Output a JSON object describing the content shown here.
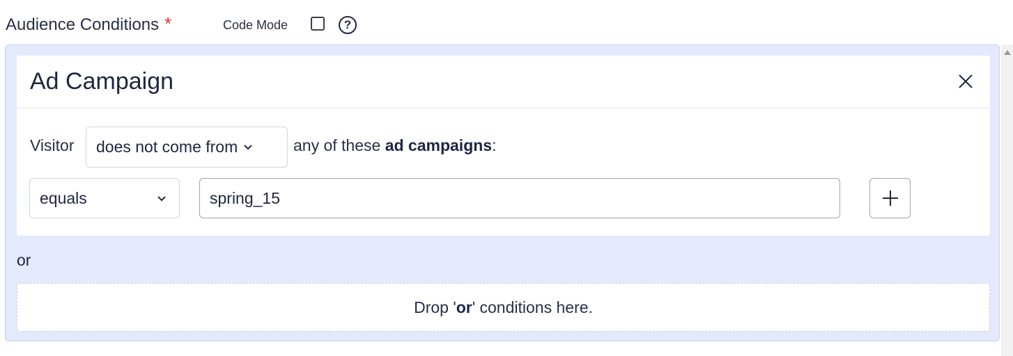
{
  "section": {
    "title": "Audience Conditions",
    "required_marker": "*",
    "code_mode_label": "Code Mode",
    "code_mode_checked": false,
    "help_glyph": "?"
  },
  "card": {
    "title": "Ad Campaign",
    "close_icon": "close-icon",
    "visitor_label": "Visitor",
    "mode_selected": "does not come from",
    "tail_prefix": "any of these ",
    "tail_bold": "ad campaigns",
    "tail_suffix": ":",
    "match_selected": "equals",
    "value": "spring_15",
    "add_icon": "plus-icon"
  },
  "or_label": "or",
  "drop_zone": {
    "prefix": "Drop '",
    "bold": "or",
    "suffix": "' conditions here."
  },
  "colors": {
    "panel_bg": "#e4e9fd",
    "required": "#e5362c",
    "text": "#1f2542"
  }
}
